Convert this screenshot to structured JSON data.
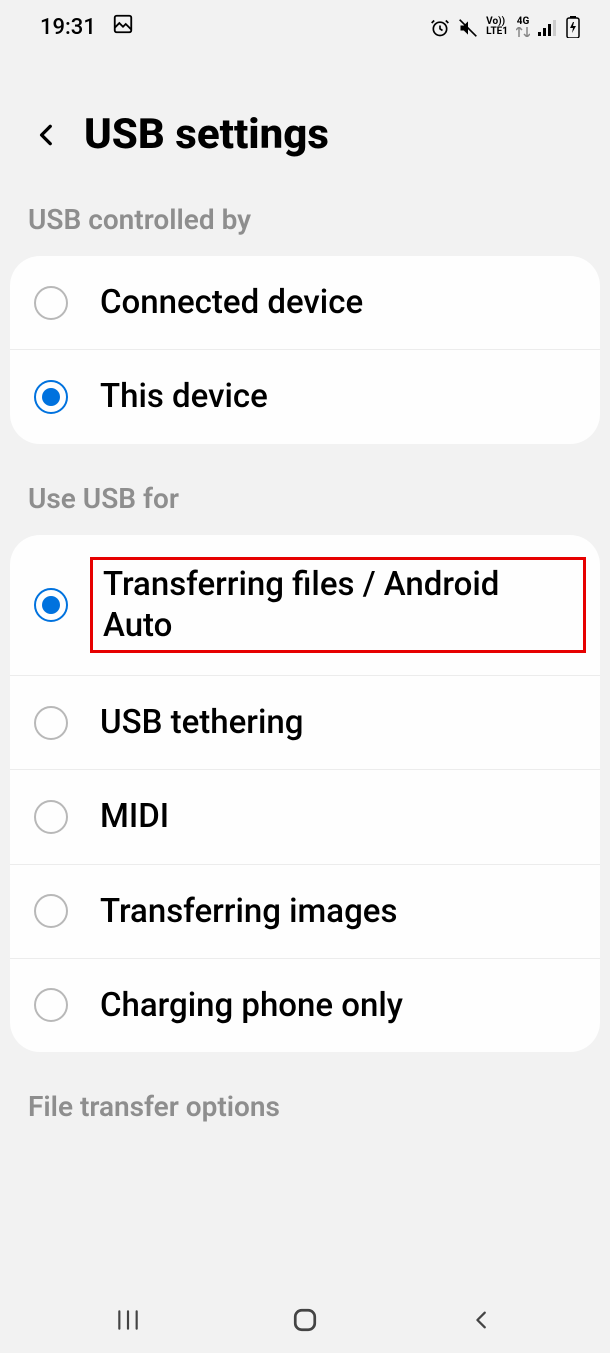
{
  "status": {
    "time": "19:31",
    "volte": "Vo))",
    "lte": "LTE1",
    "net": "4G"
  },
  "header": {
    "title": "USB settings"
  },
  "sections": {
    "controlled_by": {
      "label": "USB controlled by",
      "options": {
        "connected_device": "Connected device",
        "this_device": "This device"
      }
    },
    "use_for": {
      "label": "Use USB for",
      "options": {
        "transferring_files": "Transferring files / Android Auto",
        "usb_tethering": "USB tethering",
        "midi": "MIDI",
        "transferring_images": "Transferring images",
        "charging_only": "Charging phone only"
      }
    },
    "file_transfer": {
      "label": "File transfer options"
    }
  }
}
